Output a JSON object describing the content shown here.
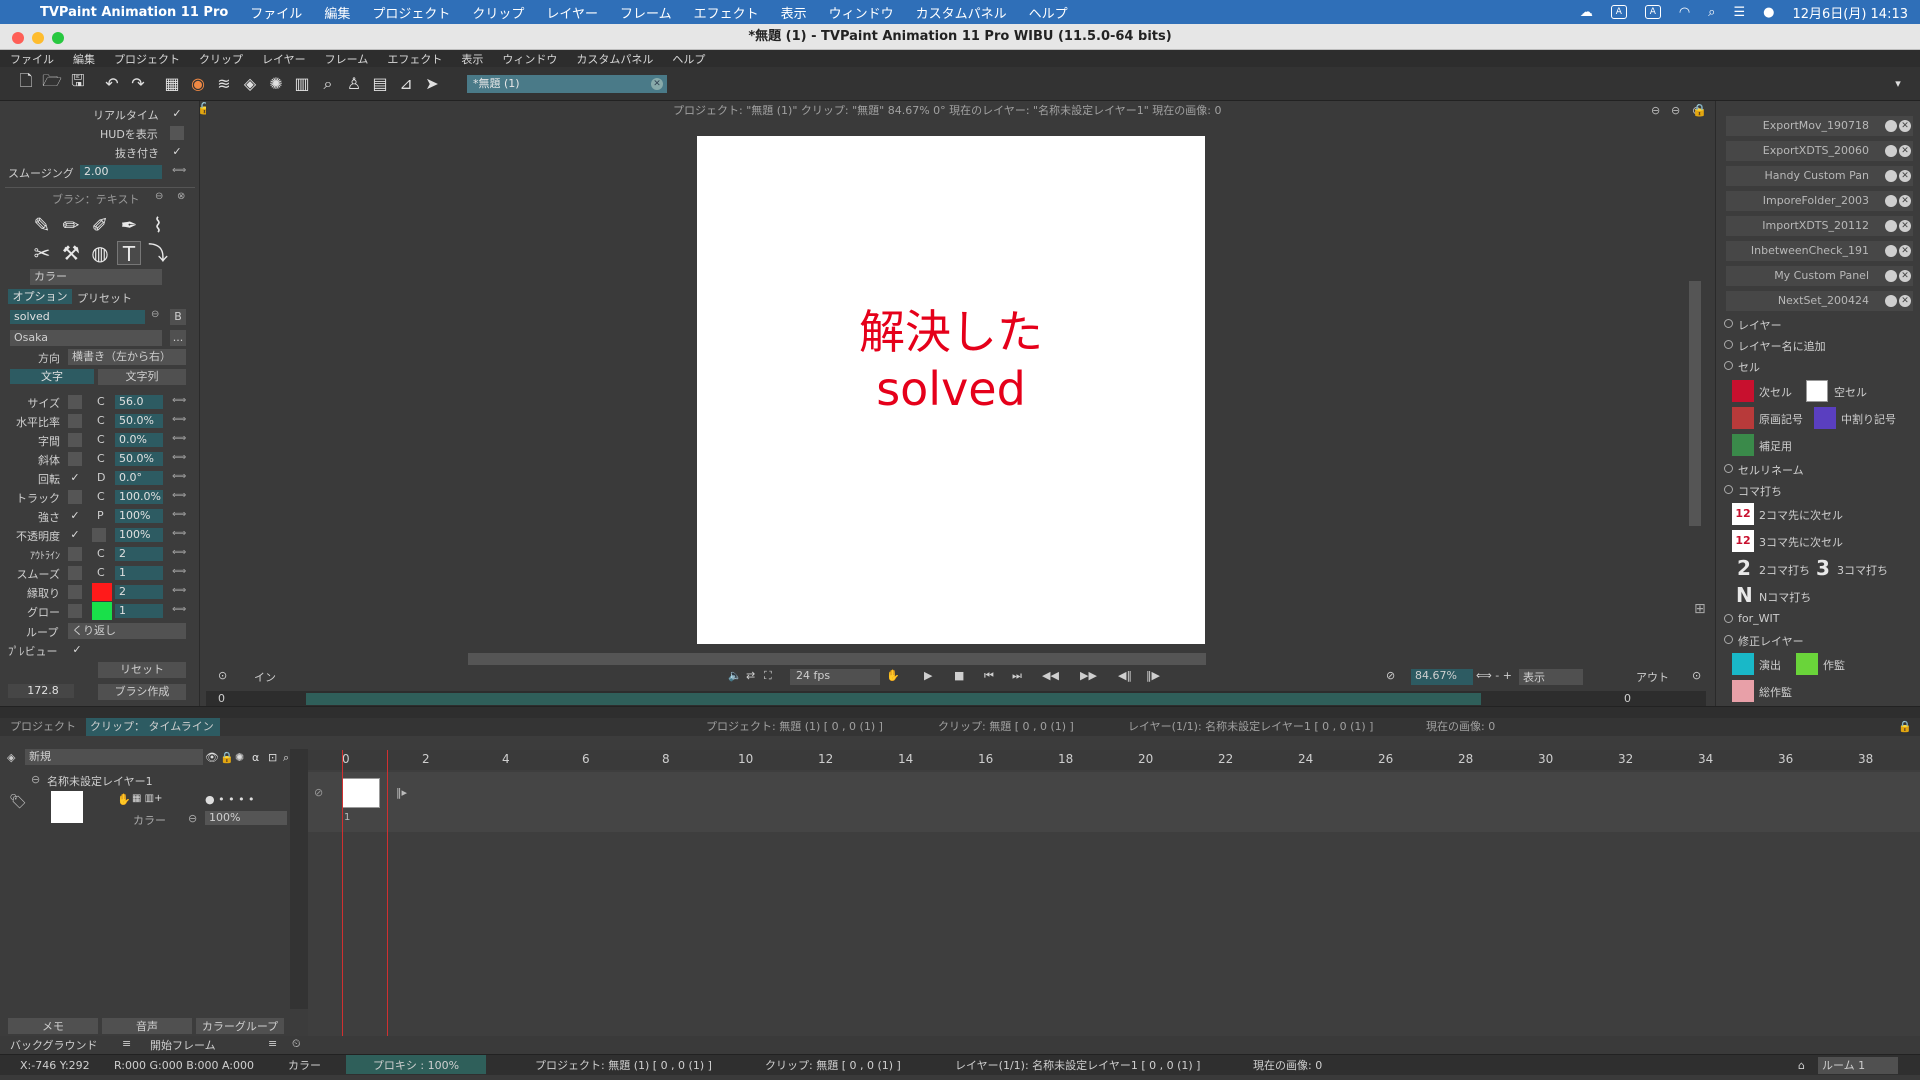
{
  "mac_menubar": {
    "app_name": "TVPaint Animation 11 Pro",
    "items": [
      "ファイル",
      "編集",
      "プロジェクト",
      "クリップ",
      "レイヤー",
      "フレーム",
      "エフェクト",
      "表示",
      "ウィンドウ",
      "カスタムパネル",
      "ヘルプ"
    ],
    "clock": "12月6日(月)  14:13"
  },
  "window": {
    "title": "*無題 (1) - TVPaint Animation 11 Pro WIBU (11.5.0-64 bits)"
  },
  "app_menu": [
    "ファイル",
    "編集",
    "プロジェクト",
    "クリップ",
    "レイヤー",
    "フレーム",
    "エフェクト",
    "表示",
    "ウィンドウ",
    "カスタムパネル",
    "ヘルプ"
  ],
  "toolbar": {
    "doc_tab": "*無題 (1)"
  },
  "left_panel": {
    "realtime": "リアルタイム",
    "show_hud": "HUDを表示",
    "cutout": "抜き付き",
    "smoothing_label": "スムージング",
    "smoothing_value": "2.00",
    "brush_title": "ブラシ：テキスト",
    "color_label": "カラー",
    "tab_options": "オプション",
    "tab_presets": "プリセット",
    "text_value": "solved",
    "bold_btn": "B",
    "font_value": "Osaka",
    "font_more": "...",
    "direction_label": "方向",
    "direction_value": "横書き（左から右）",
    "tab_char": "文字",
    "tab_string": "文字列",
    "params": [
      {
        "label": "サイズ",
        "mode": "C",
        "value": "56.0"
      },
      {
        "label": "水平比率",
        "mode": "C",
        "value": "50.0%"
      },
      {
        "label": "字間",
        "mode": "C",
        "value": "0.0%"
      },
      {
        "label": "斜体",
        "mode": "C",
        "value": "50.0%"
      },
      {
        "label": "回転",
        "mode": "D",
        "value": "0.0°"
      },
      {
        "label": "トラック",
        "mode": "C",
        "value": "100.0%"
      },
      {
        "label": "強さ",
        "mode": "P",
        "value": "100%"
      },
      {
        "label": "不透明度",
        "mode": "",
        "value": "100%"
      },
      {
        "label": "ｱｳﾄﾗｲﾝ",
        "mode": "C",
        "value": "2"
      },
      {
        "label": "スムーズ",
        "mode": "C",
        "value": "1"
      },
      {
        "label": "縁取り",
        "mode": "",
        "value": "2"
      },
      {
        "label": "グロー",
        "mode": "",
        "value": "1"
      }
    ],
    "outline_color": "#ff1a1a",
    "glow_color": "#19e04a",
    "loop_label": "ループ",
    "loop_value": "くり返し",
    "preview_label": "ﾌﾟﾚビュー",
    "reset_btn": "リセット",
    "angle_value": "172.8",
    "make_brush_btn": "ブラシ作成"
  },
  "canvas": {
    "info": "プロジェクト: \"無題 (1)\"  クリップ: \"無題\"   84.67%   0°  現在のレイヤー: \"名称未設定レイヤー1\"  現在の画像: 0",
    "text_line1": "解決した",
    "text_line2": "solved",
    "text_color": "#e5001a",
    "in_label": "イン",
    "out_label": "アウト",
    "fps": "24 fps",
    "zoom": "84.67%",
    "view_label": "表示",
    "in_frame": "0",
    "out_frame": "0"
  },
  "right_panel": {
    "items": [
      "ExportMov_190718",
      "ExportXDTS_20060",
      "Handy Custom Pan",
      "ImporeFolder_2003",
      "ImportXDTS_20112",
      "InbetweenCheck_191",
      "My Custom Panel",
      "NextSet_200424"
    ],
    "sections": {
      "layer": "レイヤー",
      "add_layer_name": "レイヤー名に追加",
      "cel": "セル",
      "next_cel": "次セル",
      "empty_cel": "空セル",
      "original_mark": "原画記号",
      "inbetween_mark": "中割り記号",
      "supplement": "補足用",
      "cel_rename": "セルリネーム",
      "koma": "コマ打ち",
      "two_koma_next": "2コマ先に次セル",
      "three_koma_next": "3コマ先に次セル",
      "two_koma": "2コマ打ち",
      "three_koma": "3コマ打ち",
      "n_koma": "Nコマ打ち",
      "for_wit": "for_WIT",
      "fix_layer": "修正レイヤー",
      "direction": "演出",
      "animation_director": "作監",
      "chief_director": "総作監"
    },
    "glyph_2": "2",
    "glyph_3": "3",
    "glyph_n": "N"
  },
  "timeline": {
    "tab_project": "プロジェクト",
    "tab_clip": "クリップ：",
    "tab_timeline": "タイムライン",
    "header_project": "プロジェクト: 無題 (1) [ 0 , 0  (1) ]",
    "header_clip": "クリップ: 無題 [ 0 , 0  (1) ]",
    "header_layer": "レイヤー(1/1): 名称未設定レイヤー1 [ 0 , 0  (1) ]",
    "header_image": "現在の画像: 0",
    "new_label": "新規",
    "layer_name": "名称未設定レイヤー1",
    "layer_color": "カラー",
    "opacity": "100%",
    "frame_labels": [
      "0",
      "2",
      "4",
      "6",
      "8",
      "10",
      "12",
      "14",
      "16",
      "18",
      "20",
      "22",
      "24",
      "26",
      "28",
      "30",
      "32",
      "34",
      "36",
      "38"
    ],
    "frame_number": "1",
    "memo_btn": "メモ",
    "sound_btn": "音声",
    "color_group_btn": "カラーグループ",
    "background": "バックグラウンド",
    "start_frame": "開始フレーム"
  },
  "status": {
    "coords": "X:-746  Y:292",
    "rgba": "R:000 G:000 B:000 A:000",
    "color": "カラー",
    "proxy": "プロキシ : 100%",
    "project": "プロジェクト: 無題 (1) [ 0 , 0  (1) ]",
    "clip": "クリップ: 無題 [ 0 , 0  (1) ]",
    "layer": "レイヤー(1/1): 名称未設定レイヤー1 [ 0 , 0  (1) ]",
    "image": "現在の画像: 0",
    "room": "ルーム 1"
  }
}
